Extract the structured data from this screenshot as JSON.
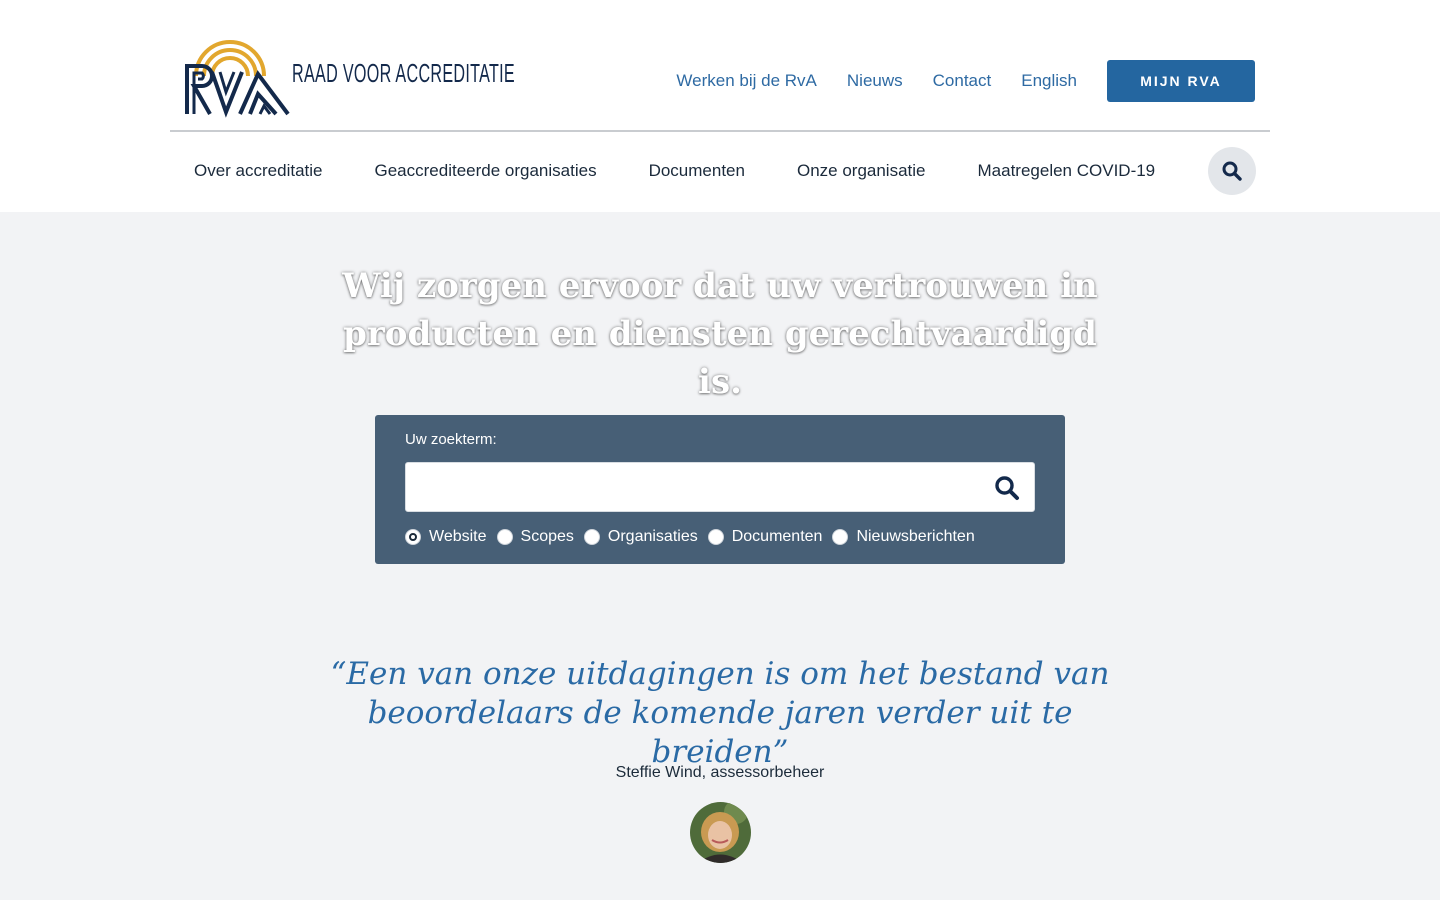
{
  "brand": {
    "name": "RAAD VOOR ACCREDITATIE",
    "colors": {
      "gold": "#e2a72e",
      "navy": "#13294b",
      "link": "#2e6aa3",
      "button": "#2466a0",
      "panel": "#475f76",
      "quote": "#2a6aa5"
    }
  },
  "topnav": {
    "links": [
      "Werken bij de RvA",
      "Nieuws",
      "Contact",
      "English"
    ],
    "button": "MIJN RVA"
  },
  "mainnav": {
    "items": [
      "Over accreditatie",
      "Geaccrediteerde organisaties",
      "Documenten",
      "Onze organisatie",
      "Maatregelen COVID-19"
    ],
    "search_icon": "search-icon"
  },
  "hero": {
    "title": "Wij zorgen ervoor dat uw vertrouwen in producten en diensten gerechtvaardigd is."
  },
  "search": {
    "label": "Uw zoekterm:",
    "value": "",
    "placeholder": "",
    "options": [
      "Website",
      "Scopes",
      "Organisaties",
      "Documenten",
      "Nieuwsberichten"
    ],
    "selected": "Website"
  },
  "quote": {
    "text": "“Een van onze uitdagingen is om het bestand van beoordelaars de komende jaren verder uit te breiden”",
    "author": "Steffie Wind, assessorbeheer"
  }
}
